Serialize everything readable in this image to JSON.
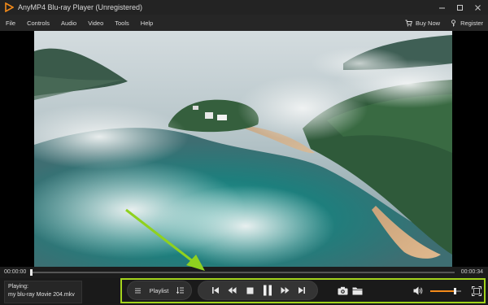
{
  "window": {
    "title": "AnyMP4 Blu-ray Player (Unregistered)",
    "controls": [
      "minimize",
      "maximize",
      "close"
    ]
  },
  "menu": {
    "items": [
      "File",
      "Controls",
      "Audio",
      "Video",
      "Tools",
      "Help"
    ],
    "buy_now": "Buy Now",
    "register": "Register"
  },
  "video": {
    "description_icon": "video-frame"
  },
  "seek": {
    "current_time": "00:00:00",
    "total_time": "00:00:34",
    "progress": 0.0
  },
  "now_playing": {
    "label": "Playing:",
    "file": "my blu-ray Movie 204.mkv"
  },
  "controls": {
    "playlist_label": "Playlist",
    "volume_level": 0.8
  },
  "colors": {
    "accent": "#f28a1a",
    "highlight": "#a4d41c",
    "arrow": "#8fd11f"
  }
}
